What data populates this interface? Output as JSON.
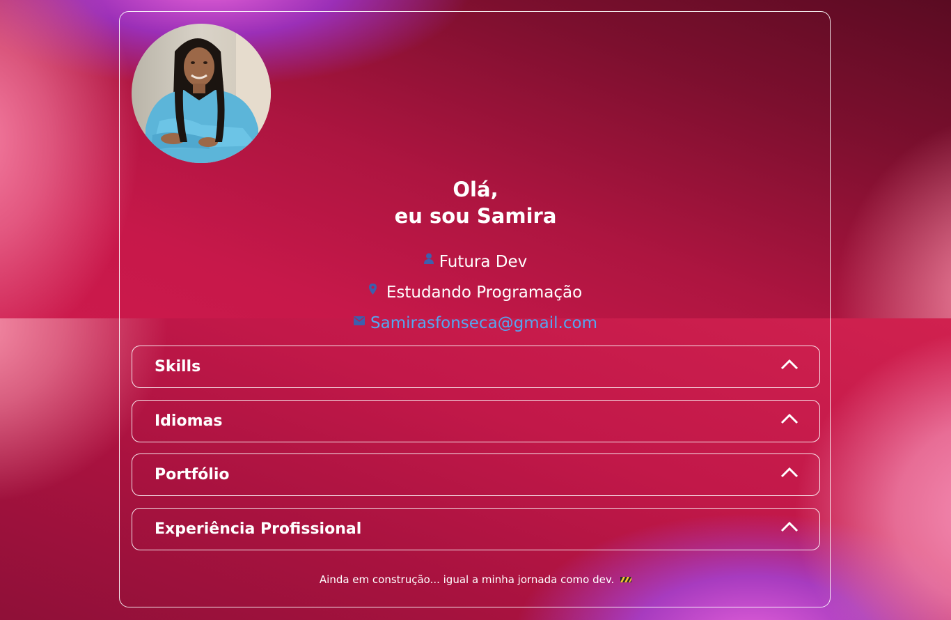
{
  "profile": {
    "photo_alt": "Samira",
    "greeting_line1": "Olá,",
    "greeting_line2": "eu sou Samira",
    "role": "Futura Dev",
    "status": "Estudando Programação",
    "email": "Samirasfonseca@gmail.com"
  },
  "icons": {
    "role": "user-icon",
    "status": "location-pin-icon",
    "email": "mail-icon",
    "accordion": "chevron-up-icon",
    "footer": "construction-icon"
  },
  "sections": [
    {
      "label": "Skills",
      "expanded": false
    },
    {
      "label": "Idiomas",
      "expanded": false
    },
    {
      "label": "Portfólio",
      "expanded": false
    },
    {
      "label": "Experiência Profissional",
      "expanded": false
    }
  ],
  "footer": {
    "text": "Ainda em construção... igual a minha jornada como dev."
  },
  "colors": {
    "icon": "#3d5fae",
    "email_link": "#55a6f0",
    "text": "#ffffff"
  }
}
